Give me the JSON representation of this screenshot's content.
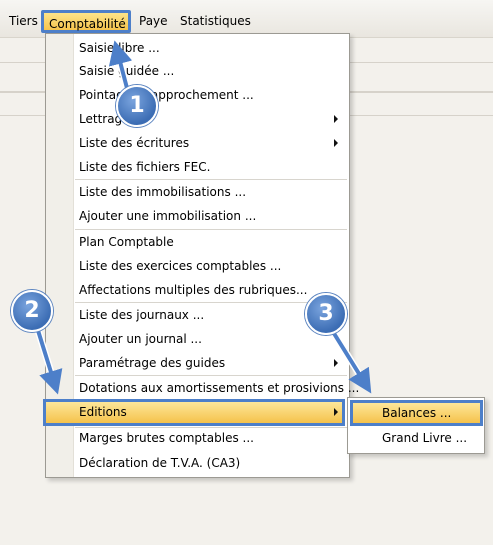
{
  "menubar": {
    "items": [
      "Tiers",
      "Comptabilité",
      "Paye",
      "Statistiques"
    ]
  },
  "menu": {
    "items": [
      "Saisie libre ...",
      "Saisie guidée ...",
      "Pointage / Rapprochement ...",
      "Lettrage",
      "Liste des écritures",
      "Liste des fichiers FEC.",
      "Liste des immobilisations ...",
      "Ajouter une immobilisation ...",
      "Plan Comptable",
      "Liste des exercices comptables ...",
      "Affectations multiples des rubriques...",
      "Liste des journaux ...",
      "Ajouter un journal ...",
      "Paramétrage des guides",
      "Dotations aux amortissements et prosivions ...",
      "Editions",
      "Marges brutes comptables ...",
      "Déclaration de T.V.A. (CA3)"
    ]
  },
  "submenu": {
    "items": [
      "Balances ...",
      "Grand Livre ..."
    ]
  },
  "callouts": [
    "1",
    "2",
    "3"
  ],
  "colors": {
    "highlight": "#f6c44c",
    "callout": "#3c6db4"
  }
}
